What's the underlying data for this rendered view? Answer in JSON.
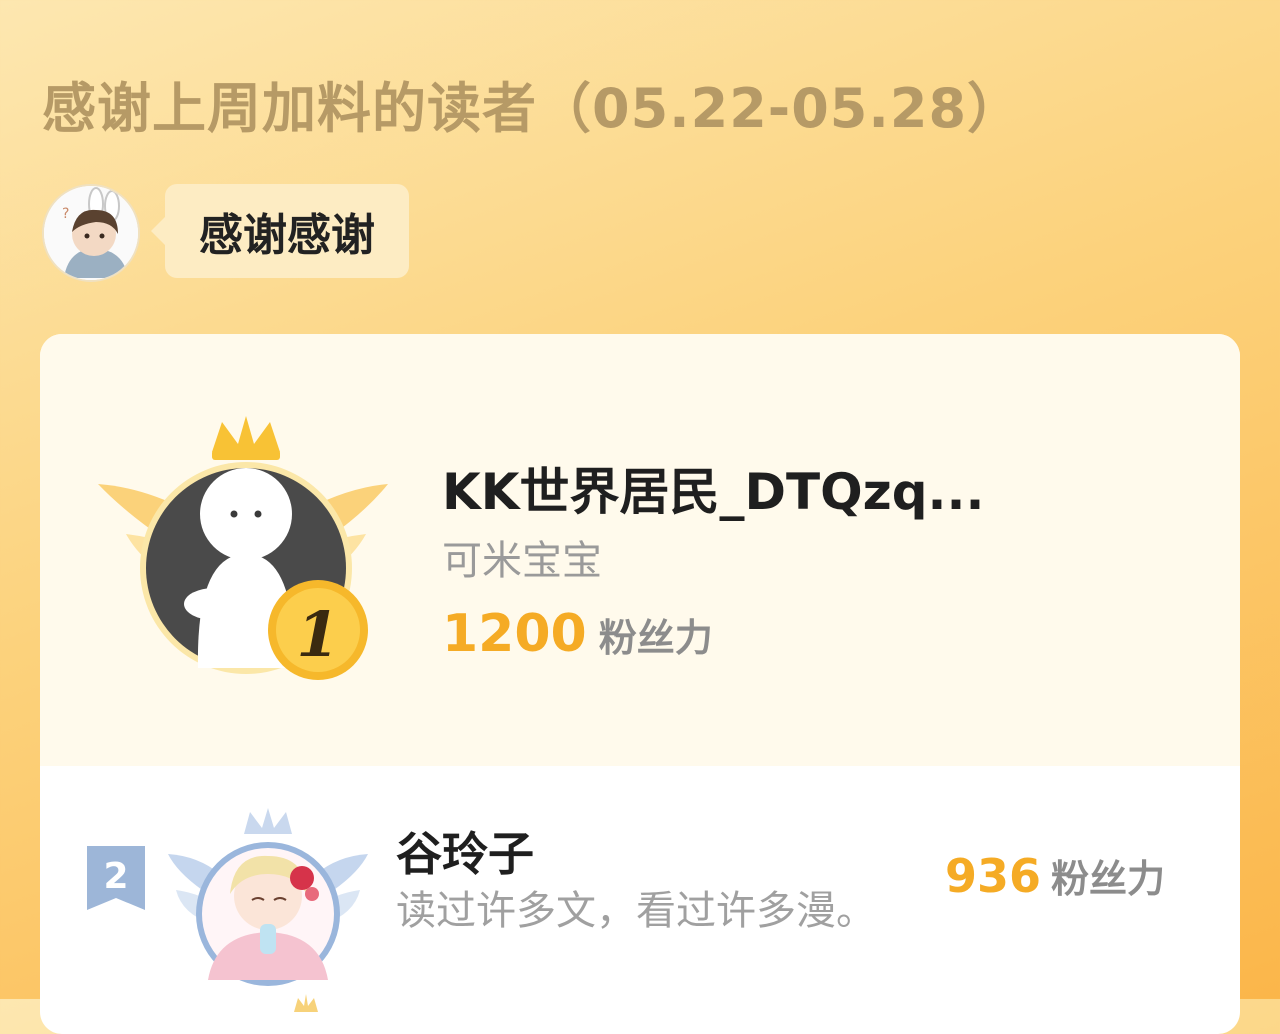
{
  "title": "感谢上周加料的读者（05.22-05.28）",
  "host": {
    "avatar_icon": "bunny-ear-avatar-icon",
    "message": "感谢感谢"
  },
  "ranking": [
    {
      "rank": "1",
      "name": "KK世界居民_DTQzq...",
      "subtitle": "可米宝宝",
      "value": "1200",
      "unit": "粉丝力",
      "badge_icon": "gold-crown-wings-icon",
      "avatar_icon": "white-ghost-avatar-icon"
    },
    {
      "rank": "2",
      "name": "谷玲子",
      "subtitle": "读过许多文，看过许多漫。",
      "value": "936",
      "unit": "粉丝力",
      "badge_icon": "silver-crown-wings-icon",
      "avatar_icon": "anime-girl-avatar-icon"
    }
  ],
  "colors": {
    "accent": "#f5ab25",
    "title": "#b69a66",
    "gold": "#f7c43a",
    "silver": "#9ab6dc"
  }
}
